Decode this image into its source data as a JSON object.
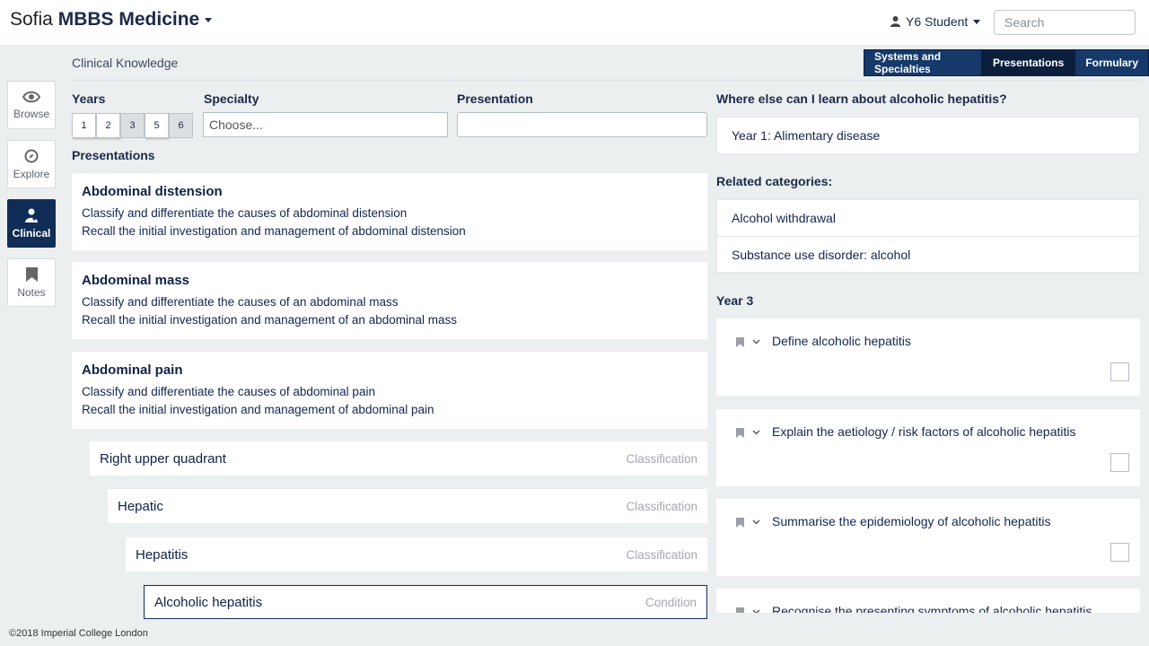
{
  "header": {
    "brand_light": "Sofia",
    "brand_bold": "MBBS Medicine",
    "user_label": "Y6 Student",
    "search_placeholder": "Search"
  },
  "sidebar": {
    "items": [
      {
        "label": "Browse",
        "icon": "eye-icon",
        "active": false
      },
      {
        "label": "Explore",
        "icon": "compass-icon",
        "active": false
      },
      {
        "label": "Clinical",
        "icon": "doctor-icon",
        "active": true
      },
      {
        "label": "Notes",
        "icon": "bookmark-icon",
        "active": false
      }
    ]
  },
  "breadcrumb": "Clinical Knowledge",
  "view_tabs": [
    {
      "label": "Systems and Specialties",
      "active": false
    },
    {
      "label": "Presentations",
      "active": true
    },
    {
      "label": "Formulary",
      "active": false
    }
  ],
  "filters": {
    "years_label": "Years",
    "years": [
      {
        "label": "1",
        "selected": true
      },
      {
        "label": "2",
        "selected": true
      },
      {
        "label": "3",
        "selected": false
      },
      {
        "label": "5",
        "selected": true
      },
      {
        "label": "6",
        "selected": false
      }
    ],
    "specialty_label": "Specialty",
    "specialty_placeholder": "Choose...",
    "presentation_label": "Presentation",
    "presentation_value": ""
  },
  "presentations_heading": "Presentations",
  "presentations": [
    {
      "title": "Abdominal distension",
      "lines": [
        "Classify and differentiate the causes of abdominal distension",
        "Recall the initial investigation and management of abdominal distension"
      ]
    },
    {
      "title": "Abdominal mass",
      "lines": [
        "Classify and differentiate the causes of an abdominal mass",
        "Recall the initial investigation and management of an abdominal mass"
      ]
    },
    {
      "title": "Abdominal pain",
      "lines": [
        "Classify and differentiate the causes of abdominal pain",
        "Recall the initial investigation and management of abdominal pain"
      ]
    }
  ],
  "tree": [
    {
      "label": "Right upper quadrant",
      "kind": "Classification"
    },
    {
      "label": "Hepatic",
      "kind": "Classification"
    },
    {
      "label": "Hepatitis",
      "kind": "Classification"
    },
    {
      "label": "Alcoholic hepatitis",
      "kind": "Condition"
    }
  ],
  "right": {
    "learn_heading": "Where else can I learn about alcoholic hepatitis?",
    "learn_items": [
      "Year 1: Alimentary disease"
    ],
    "related_heading": "Related categories:",
    "related_items": [
      "Alcohol withdrawal",
      "Substance use disorder: alcohol"
    ],
    "year_heading": "Year 3",
    "objectives": [
      "Define alcoholic hepatitis",
      "Explain the aetiology / risk factors of alcoholic hepatitis",
      "Summarise the epidemiology of alcoholic hepatitis",
      "Recognise the presenting symptoms of alcoholic hepatitis"
    ]
  },
  "footer": "©2018 Imperial College London"
}
